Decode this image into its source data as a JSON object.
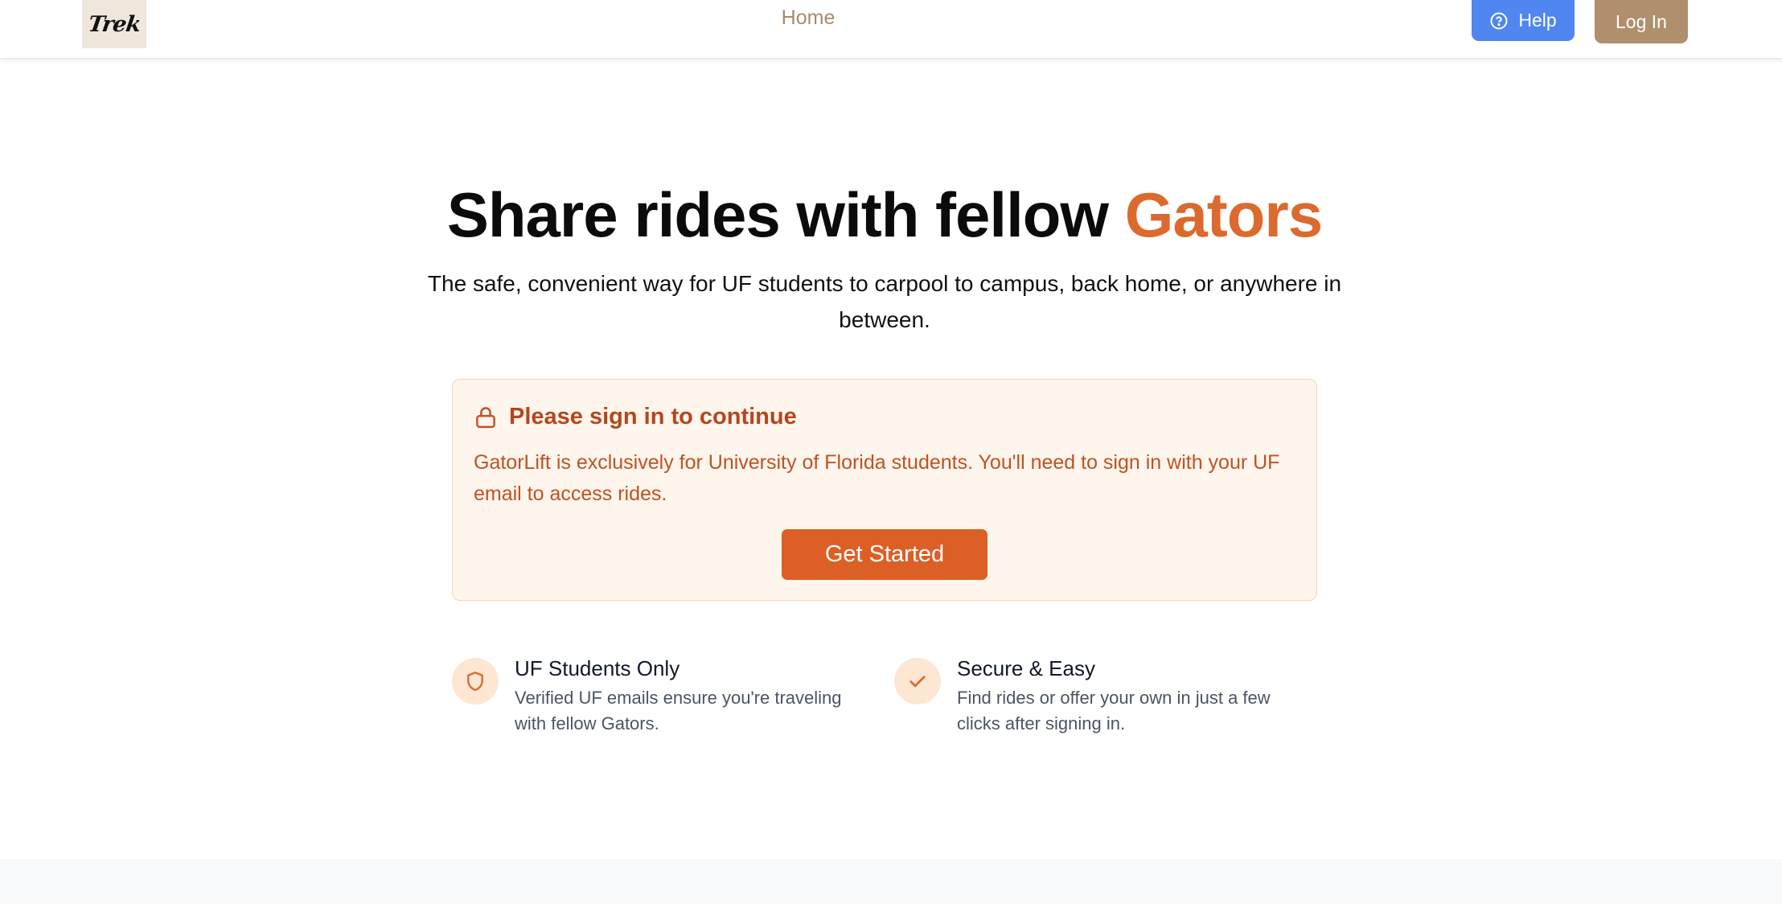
{
  "header": {
    "logo_text": "Trek",
    "nav_home": "Home",
    "help_label": "Help",
    "login_label": "Log In"
  },
  "hero": {
    "title_main": "Share rides with fellow ",
    "title_accent": "Gators",
    "subtitle": "The safe, convenient way for UF students to carpool to campus, back home, or anywhere in between."
  },
  "notice": {
    "icon": "lock-icon",
    "title": "Please sign in to continue",
    "body": "GatorLift is exclusively for University of Florida students. You'll need to sign in with your UF email to access rides.",
    "button_label": "Get Started"
  },
  "features": [
    {
      "icon": "shield-icon",
      "title": "UF Students Only",
      "description": "Verified UF emails ensure you're traveling with fellow Gators."
    },
    {
      "icon": "check-icon",
      "title": "Secure & Easy",
      "description": "Find rides or offer your own in just a few clicks after signing in."
    }
  ],
  "colors": {
    "accent": "#dc6a2e",
    "help_button": "#4f86ef",
    "login_button": "#b08f6c",
    "notice_bg": "#fef5ec",
    "notice_text": "#b5461d"
  }
}
